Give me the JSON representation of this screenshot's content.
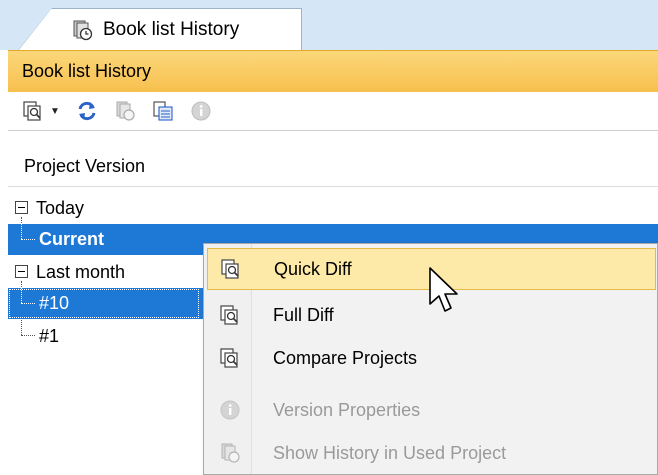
{
  "tab": {
    "label": "Book list History",
    "icon": "history-icon"
  },
  "panel": {
    "title": "Book list History"
  },
  "toolbar": {
    "buttons": [
      {
        "name": "compare-icon",
        "has_dropdown": true
      },
      {
        "name": "refresh-icon"
      },
      {
        "name": "history-icon"
      },
      {
        "name": "report-icon"
      },
      {
        "name": "info-icon"
      }
    ]
  },
  "tree": {
    "column_header": "Project Version",
    "nodes": [
      {
        "label": "Today",
        "level": 0,
        "expanded": true
      },
      {
        "label": "Current",
        "level": 1,
        "selected": true,
        "bold": true
      },
      {
        "label": "Last month",
        "level": 0,
        "expanded": true
      },
      {
        "label": "#10",
        "level": 1,
        "selected": true
      },
      {
        "label": "#1",
        "level": 1
      }
    ]
  },
  "context_menu": {
    "items": [
      {
        "label": "Quick Diff",
        "icon": "compare-icon",
        "enabled": true,
        "hover": true
      },
      {
        "label": "Full Diff",
        "icon": "compare-icon",
        "enabled": true
      },
      {
        "label": "Compare Projects",
        "icon": "compare-icon",
        "enabled": true
      },
      {
        "label": "Version Properties",
        "icon": "info-icon",
        "enabled": false
      },
      {
        "label": "Show History in Used Project",
        "icon": "history-icon",
        "enabled": false
      }
    ]
  },
  "colors": {
    "selection": "#1e78d6",
    "panel_title": "#f7c04e",
    "menu_hover": "#fde9a8",
    "tab_strip": "#d5e6f7"
  }
}
